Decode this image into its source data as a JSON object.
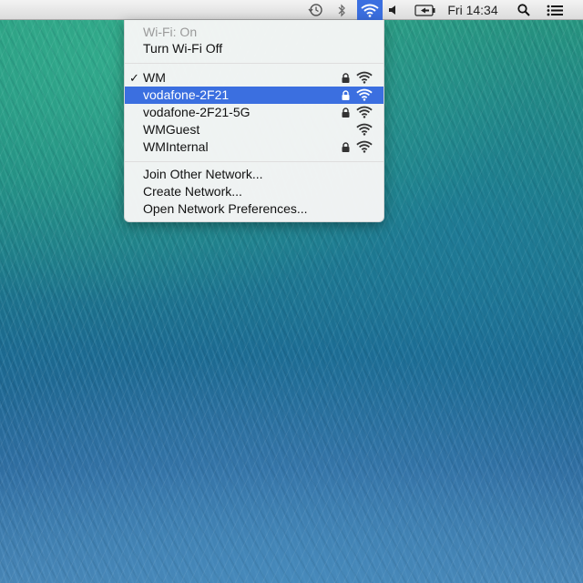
{
  "menubar": {
    "items": [
      {
        "icon": "time-machine-icon"
      },
      {
        "icon": "bluetooth-icon"
      },
      {
        "icon": "wifi-icon"
      },
      {
        "icon": "volume-icon"
      },
      {
        "icon": "battery-icon"
      }
    ],
    "clock": "Fri 14:34",
    "search_icon": "spotlight-search-icon",
    "list_icon": "notification-center-icon",
    "accent": "#3b6fe0"
  },
  "wifi_menu": {
    "status": "Wi-Fi: On",
    "toggle": "Turn Wi-Fi Off",
    "networks": [
      {
        "name": "WM",
        "checked": true,
        "locked": true
      },
      {
        "name": "vodafone-2F21",
        "checked": false,
        "locked": true,
        "highlighted": true
      },
      {
        "name": "vodafone-2F21-5G",
        "checked": false,
        "locked": true
      },
      {
        "name": "WMGuest",
        "checked": false,
        "locked": false
      },
      {
        "name": "WMInternal",
        "checked": false,
        "locked": true
      }
    ],
    "actions": [
      "Join Other Network...",
      "Create Network...",
      "Open Network Preferences..."
    ],
    "check_glyph": "✓"
  }
}
